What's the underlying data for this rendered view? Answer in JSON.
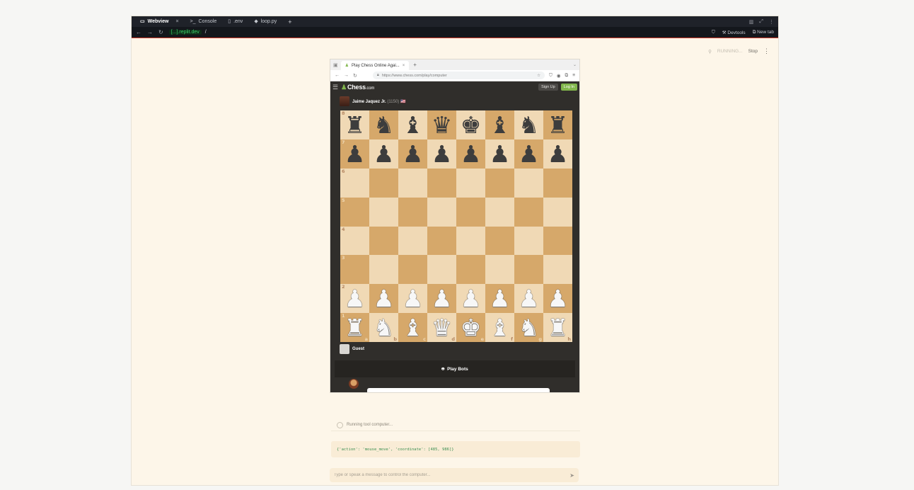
{
  "outer_tabs": [
    {
      "icon": "monitor-icon",
      "glyph": "▭",
      "label": "Webview",
      "active": true
    },
    {
      "icon": "terminal-icon",
      "glyph": ">_",
      "label": "Console",
      "active": false
    },
    {
      "icon": "file-icon",
      "glyph": "▯",
      "label": ".env",
      "active": false
    },
    {
      "icon": "python-icon",
      "glyph": "◆",
      "label": "loop.py",
      "active": false
    }
  ],
  "outer_url": {
    "host": "[...].replit.dev",
    "path": "/"
  },
  "outer_actions": {
    "devtools": "Devtools",
    "new_tab": "New tab"
  },
  "status": {
    "running": "RUNNING...",
    "stop": "Stop"
  },
  "inner_browser": {
    "tab_title": "Play Chess Online Agai...",
    "url": "https://www.chess.com/play/computer"
  },
  "chess_header": {
    "logo": "Chess",
    "logo_suffix": ".com",
    "signup": "Sign Up",
    "login": "Log In"
  },
  "opponent": {
    "name": "Jaime Jaquez Jr.",
    "rating": "(1150)",
    "flag": "🇺🇸"
  },
  "guest": {
    "name": "Guest"
  },
  "play_bots_label": "Play Bots",
  "board": {
    "ranks": [
      "8",
      "7",
      "6",
      "5",
      "4",
      "3",
      "2",
      "1"
    ],
    "files": [
      "a",
      "b",
      "c",
      "d",
      "e",
      "f",
      "g",
      "h"
    ],
    "rows": [
      [
        "br",
        "bn",
        "bb",
        "bq",
        "bk",
        "bb",
        "bn",
        "br"
      ],
      [
        "bp",
        "bp",
        "bp",
        "bp",
        "bp",
        "bp",
        "bp",
        "bp"
      ],
      [
        "",
        "",
        "",
        "",
        "",
        "",
        "",
        ""
      ],
      [
        "",
        "",
        "",
        "",
        "",
        "",
        "",
        ""
      ],
      [
        "",
        "",
        "",
        "",
        "",
        "",
        "",
        ""
      ],
      [
        "",
        "",
        "",
        "",
        "",
        "",
        "",
        ""
      ],
      [
        "wp",
        "wp",
        "wp",
        "wp",
        "wp",
        "wp",
        "wp",
        "wp"
      ],
      [
        "wr",
        "wn",
        "wb",
        "wq",
        "wk",
        "wb",
        "wn",
        "wr"
      ]
    ]
  },
  "chat": {
    "tool_status": "Running tool computer...",
    "tool_input": "{'action': 'mouse_move', 'coordinate': [485, 986]}",
    "input_placeholder": "Type or speak a message to control the computer..."
  }
}
